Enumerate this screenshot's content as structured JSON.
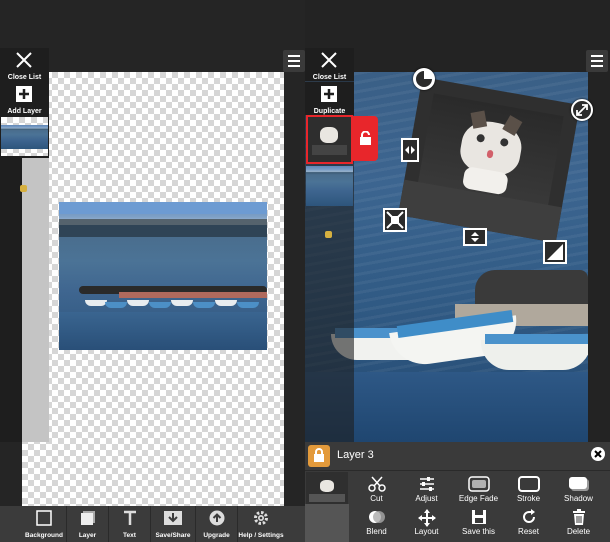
{
  "left": {
    "side": {
      "close_label": "Close List",
      "add_label": "Add Layer"
    },
    "toolbar": [
      {
        "label": "Background",
        "icon": "background-icon"
      },
      {
        "label": "Layer",
        "icon": "layer-icon"
      },
      {
        "label": "Text",
        "icon": "text-icon"
      },
      {
        "label": "Save/Share",
        "icon": "save-share-icon"
      },
      {
        "label": "Upgrade",
        "icon": "upgrade-icon"
      },
      {
        "label": "Help / Settings",
        "icon": "gear-icon"
      }
    ]
  },
  "right": {
    "side": {
      "close_label": "Close List",
      "duplicate_label": "Duplicate"
    },
    "panel": {
      "layer_name": "Layer 3",
      "tools_row1": [
        {
          "label": "Cut",
          "icon": "scissors-icon"
        },
        {
          "label": "Adjust",
          "icon": "sliders-icon"
        },
        {
          "label": "Edge Fade",
          "icon": "edge-fade-icon"
        },
        {
          "label": "Stroke",
          "icon": "stroke-icon"
        },
        {
          "label": "Shadow",
          "icon": "shadow-icon"
        }
      ],
      "tools_row2": [
        {
          "label": "Blend",
          "icon": "blend-icon"
        },
        {
          "label": "Layout",
          "icon": "move-icon"
        },
        {
          "label": "Save this",
          "icon": "floppy-icon"
        },
        {
          "label": "Reset",
          "icon": "reset-icon"
        },
        {
          "label": "Delete",
          "icon": "trash-icon"
        }
      ]
    }
  },
  "colors": {
    "accent_red": "#e8262b",
    "lock_orange": "#e39a3b",
    "toolbar_bg": "#3b3b3b"
  }
}
